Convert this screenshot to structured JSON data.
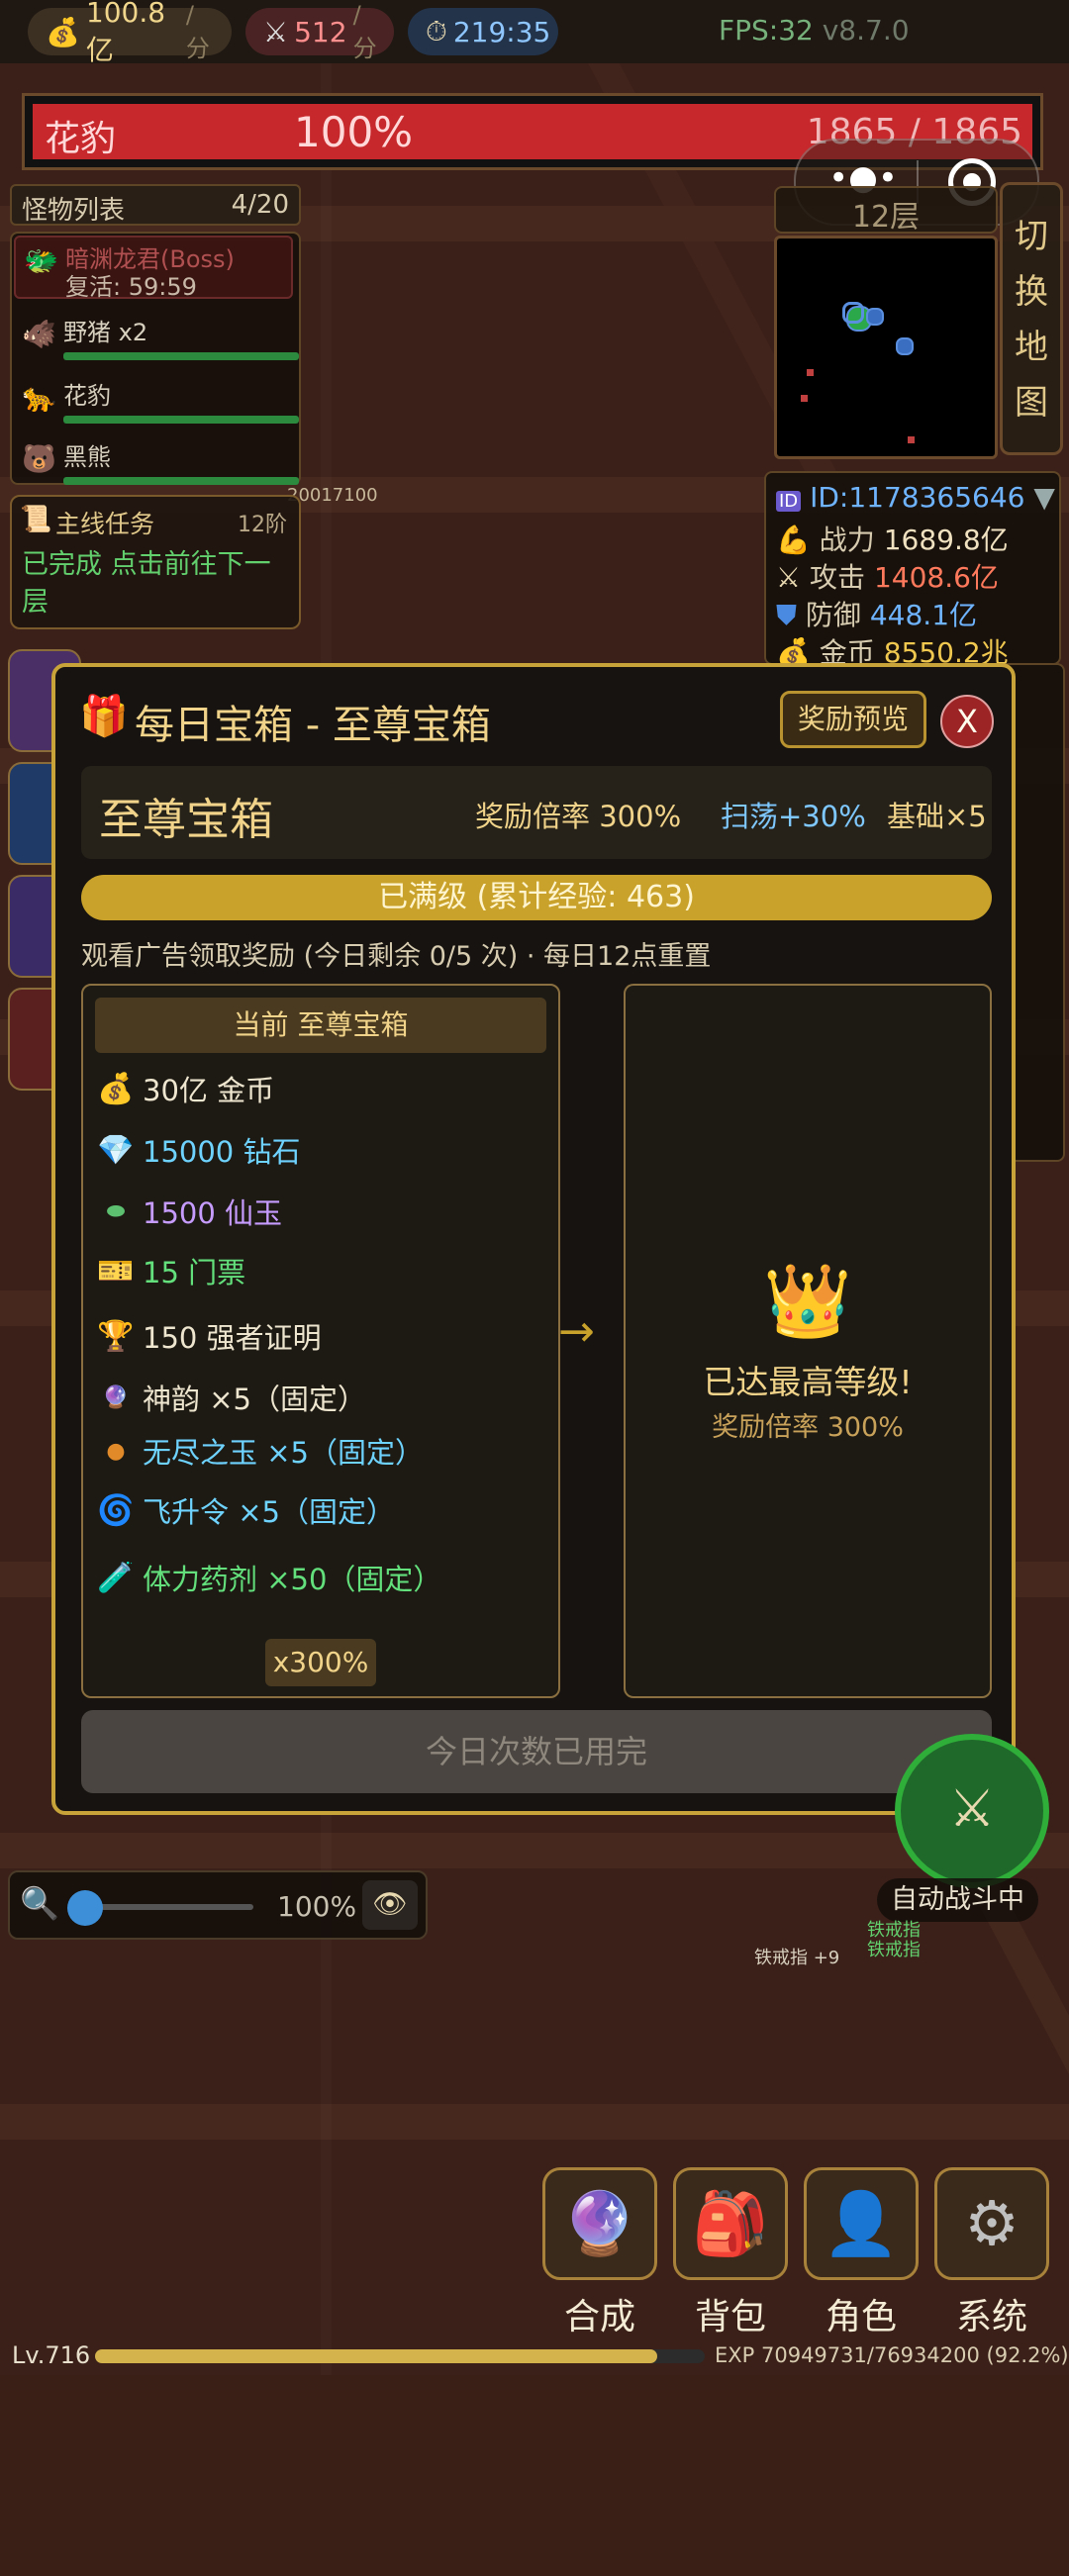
{
  "topbar": {
    "gold_rate": "100.8亿",
    "gold_unit": "/分",
    "kill_rate": "512",
    "kill_unit": "/分",
    "timer": "219:35",
    "fps": "FPS:32",
    "version": "v8.7.0"
  },
  "target": {
    "name": "花豹",
    "percent_text": "100%",
    "hp_text": "1865 / 1865",
    "hp_fraction": 1.0
  },
  "monster_list": {
    "title": "怪物列表",
    "count": "4/20",
    "items": [
      {
        "name": "暗渊龙君(Boss)",
        "sub": "复活: 59:59",
        "icon": "dragon-icon"
      },
      {
        "name": "野猪 x2",
        "icon": "boar-icon"
      },
      {
        "name": "花豹",
        "icon": "leopard-icon"
      },
      {
        "name": "黑熊",
        "icon": "bear-icon"
      }
    ],
    "floating_text": "20017100"
  },
  "quest": {
    "title": "主线任务",
    "tier": "12阶",
    "text": "已完成 点击前往下一层"
  },
  "map": {
    "floor": "12层",
    "switch_label": "切换地图"
  },
  "stats": {
    "id": "ID:1178365646",
    "power_label": "战力",
    "power": "1689.8亿",
    "attack_label": "攻击",
    "attack": "1408.6亿",
    "defense_label": "防御",
    "defense": "448.1亿",
    "gold_label": "金币",
    "gold": "8550.2兆"
  },
  "modal": {
    "title": "每日宝箱 - 至尊宝箱",
    "preview_button": "奖励预览",
    "close_button": "X",
    "chest_name": "至尊宝箱",
    "reward_rate": "奖励倍率 300%",
    "sweep": "扫荡+30%",
    "base": "基础×5",
    "level_bar": "已满级 (累计经验: 463)",
    "hint": "观看广告领取奖励 (今日剩余 0/5 次) · 每日12点重置",
    "current_tag": "当前 至尊宝箱",
    "rewards": [
      {
        "icon": "money-bag-icon",
        "text": "30亿 金币",
        "color": "#efe6cf"
      },
      {
        "icon": "diamond-icon",
        "text": "15000 钻石",
        "color": "#6fd3ff"
      },
      {
        "icon": "jade-icon",
        "text": "1500 仙玉",
        "color": "#c79cff"
      },
      {
        "icon": "ticket-icon",
        "text": "15 门票",
        "color": "#63e07c"
      },
      {
        "icon": "trophy-icon",
        "text": "150 强者证明",
        "color": "#efe6cf"
      },
      {
        "icon": "orb-icon",
        "text": "神韵 ×5（固定）",
        "color": "#efe6cf"
      },
      {
        "icon": "pearl-icon",
        "text": "无尽之玉 ×5（固定）",
        "color": "#6fd3ff"
      },
      {
        "icon": "swirl-icon",
        "text": "飞升令 ×5（固定）",
        "color": "#6fd3ff"
      },
      {
        "icon": "potion-icon",
        "text": "体力药剂 ×50（固定）",
        "color": "#63e07c"
      }
    ],
    "multiplier": "x300%",
    "max_title": "已达最高等级!",
    "max_rate": "奖励倍率 300%",
    "use_button": "今日次数已用完"
  },
  "zoom": {
    "value": "100%"
  },
  "auto_battle": "自动战斗中",
  "floor_drops": {
    "drop1": "铁戒指 +9",
    "drop2": "铁戒指",
    "drop3": "铁戒指"
  },
  "bottom_nav": [
    {
      "label": "合成",
      "icon": "crystal-ball-icon"
    },
    {
      "label": "背包",
      "icon": "backpack-icon"
    },
    {
      "label": "角色",
      "icon": "person-icon"
    },
    {
      "label": "系统",
      "icon": "gear-icon"
    }
  ],
  "exp": {
    "level": "Lv.716",
    "text": "EXP 70949731/76934200 (92.2%)",
    "fraction": 0.922
  }
}
